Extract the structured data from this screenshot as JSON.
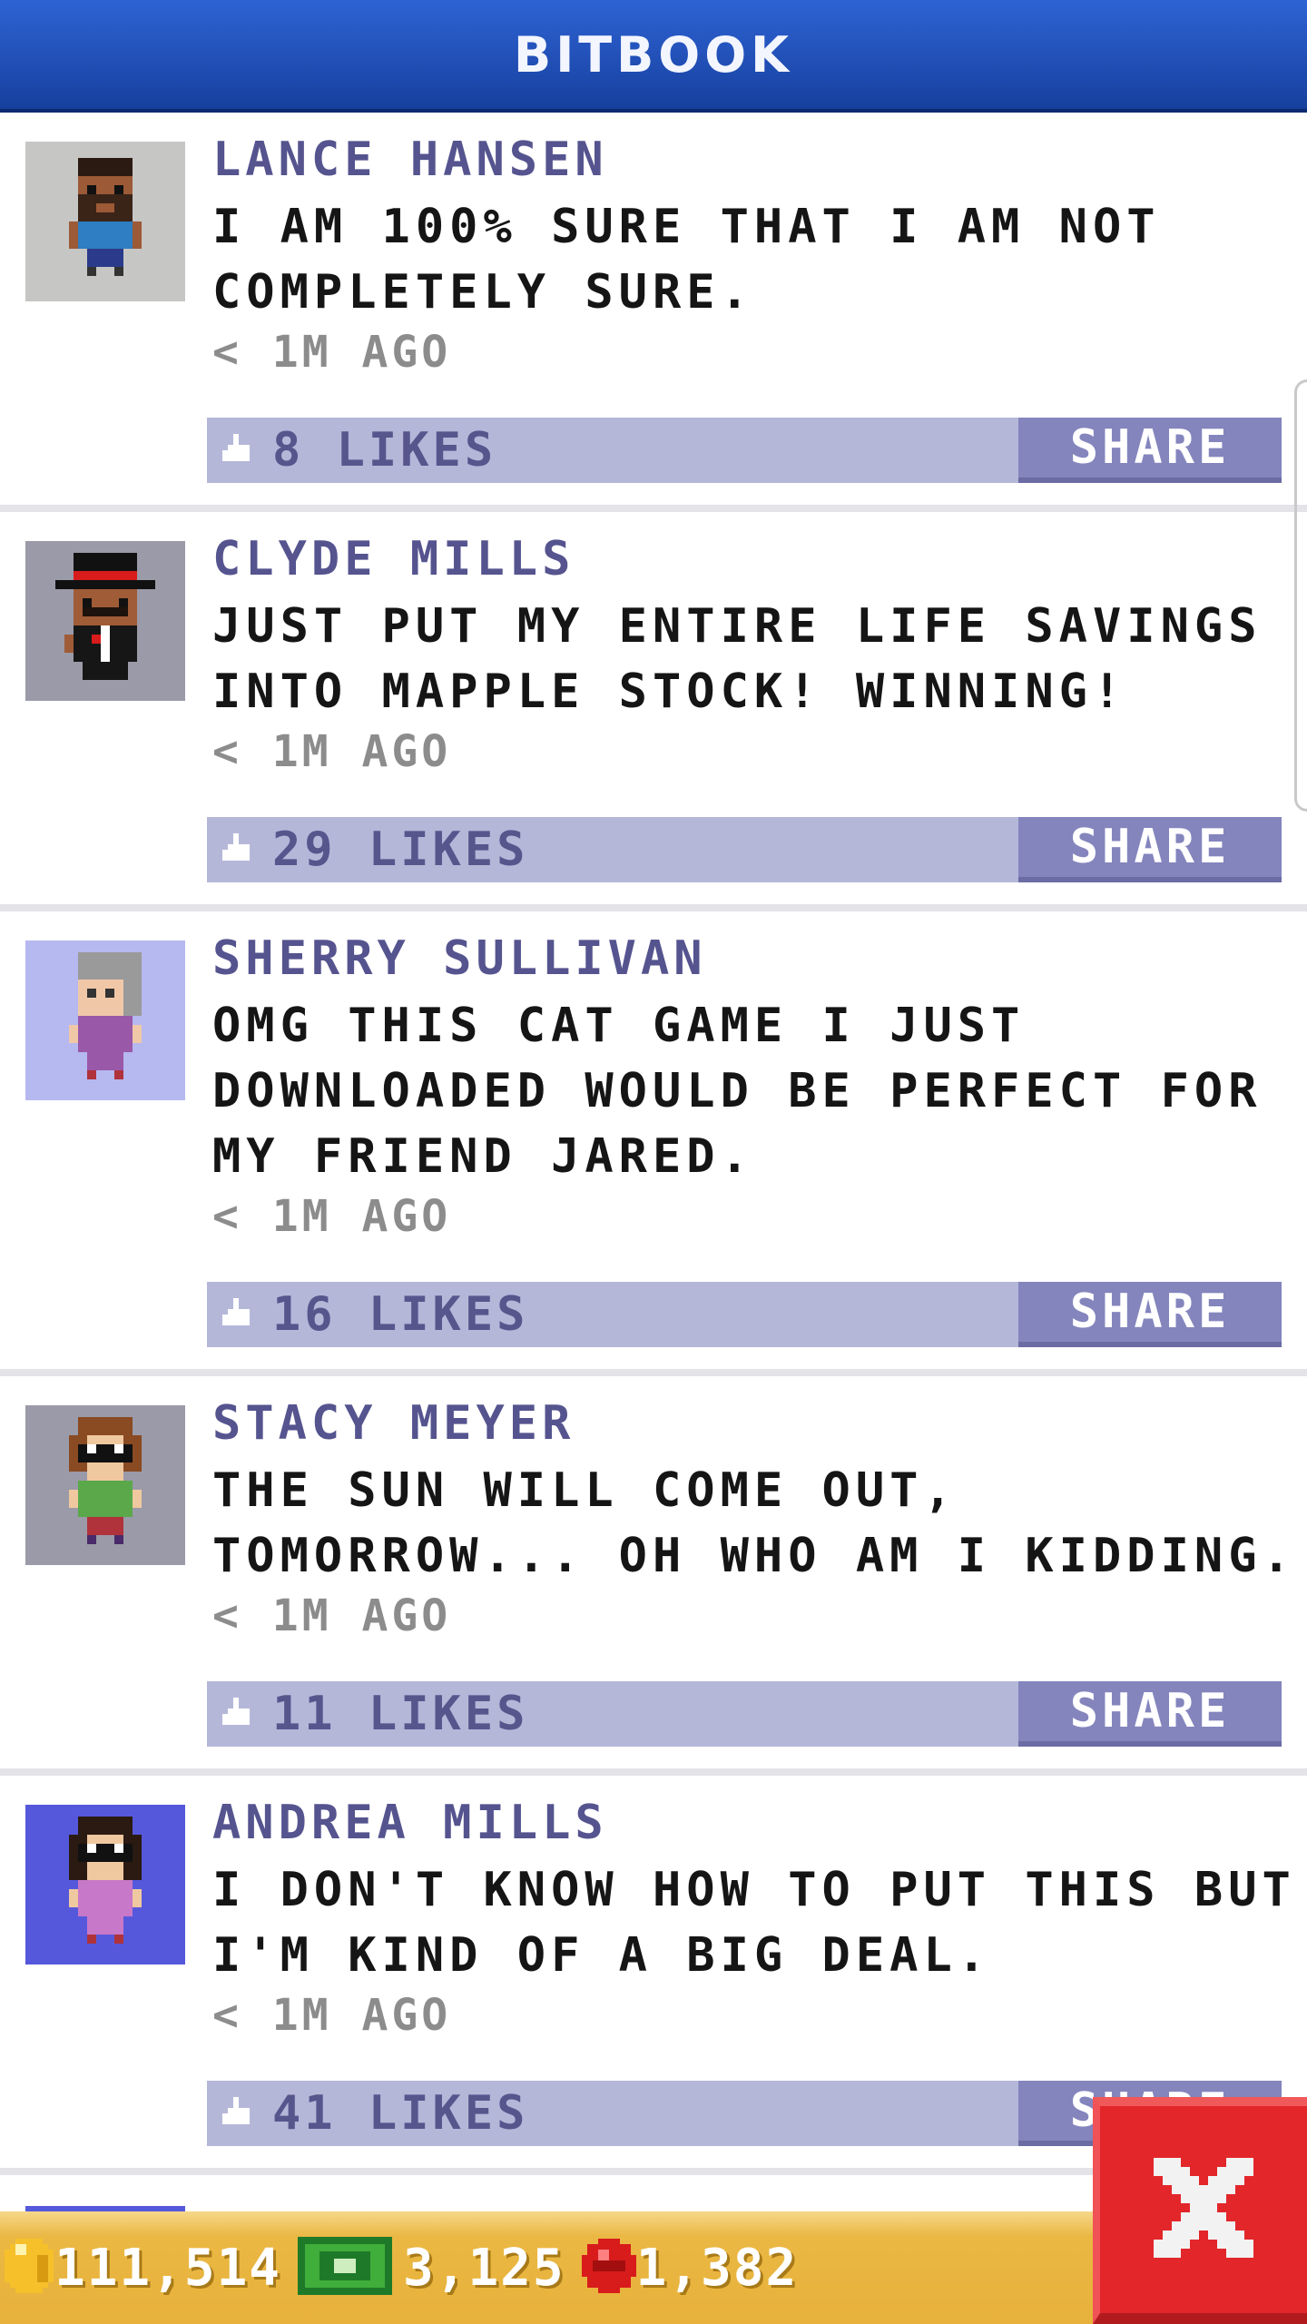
{
  "header": {
    "title": "BITBOOK"
  },
  "posts": [
    {
      "author": "LANCE HANSEN",
      "message": "I AM 100% SURE THAT I AM NOT COMPLETELY SURE.",
      "time": "< 1M AGO",
      "likes": "8 LIKES",
      "share_label": "SHARE"
    },
    {
      "author": "CLYDE MILLS",
      "message": "JUST PUT MY ENTIRE LIFE SAVINGS INTO MAPPLE STOCK! WINNING!",
      "time": "< 1M AGO",
      "likes": "29 LIKES",
      "share_label": "SHARE"
    },
    {
      "author": "SHERRY SULLIVAN",
      "message": "OMG THIS CAT GAME I JUST DOWNLOADED WOULD BE PERFECT FOR MY FRIEND JARED.",
      "time": "< 1M AGO",
      "likes": "16 LIKES",
      "share_label": "SHARE"
    },
    {
      "author": "STACY MEYER",
      "message": "THE SUN WILL COME OUT, TOMORROW... OH WHO AM I KIDDING.",
      "time": "< 1M AGO",
      "likes": "11 LIKES",
      "share_label": "SHARE"
    },
    {
      "author": "ANDREA MILLS",
      "message": "I DON'T KNOW HOW TO PUT THIS BUT I'M KIND OF A BIG DEAL.",
      "time": "< 1M AGO",
      "likes": "41 LIKES",
      "share_label": "SHARE"
    }
  ],
  "stats": {
    "coins": "111,514",
    "bux": "3,125",
    "gems": "1,382"
  },
  "icons": {
    "coin": "coin-icon",
    "bux": "bux-icon",
    "gem": "gem-icon",
    "close": "close-icon",
    "like": "like-icon"
  },
  "colors": {
    "header": "#1f4fbf",
    "like_bar": "#b5b7d9",
    "share": "#8485bd",
    "author": "#55548f",
    "close": "#e2262a",
    "stats_bar": "#e9b33e"
  }
}
